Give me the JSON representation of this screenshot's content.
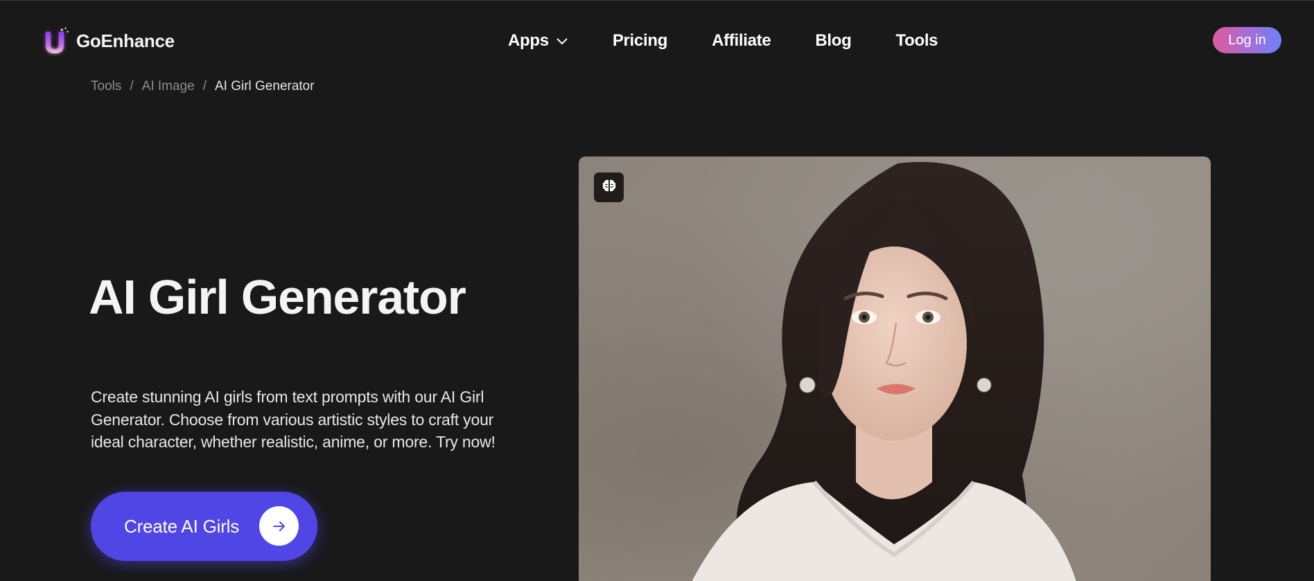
{
  "brand": {
    "name": "GoEnhance",
    "logo_icon": "u-sparkle-logo-icon"
  },
  "nav": {
    "items": [
      {
        "label": "Apps",
        "has_dropdown": true,
        "icon": "chevron-down-icon"
      },
      {
        "label": "Pricing"
      },
      {
        "label": "Affiliate"
      },
      {
        "label": "Blog"
      },
      {
        "label": "Tools"
      }
    ],
    "login_label": "Log in"
  },
  "breadcrumb": {
    "items": [
      "Tools",
      "AI Image"
    ],
    "current": "AI Girl Generator",
    "separator": "/"
  },
  "hero": {
    "title": "AI Girl Generator",
    "description": "Create stunning AI girls from text prompts with our AI Girl Generator. Choose from various artistic styles to craft your ideal character, whether realistic, anime, or more. Try now!",
    "cta_label": "Create AI Girls",
    "cta_icon": "arrow-right-icon"
  },
  "preview": {
    "badge_icon": "brain-icon",
    "image_alt": "AI generated portrait of a young woman with long dark hair wearing a white lace dress and pearl earrings"
  },
  "colors": {
    "background": "#191919",
    "cta": "#4f46e5",
    "login_gradient_start": "#e05a9f",
    "login_gradient_end": "#6f80f8"
  }
}
